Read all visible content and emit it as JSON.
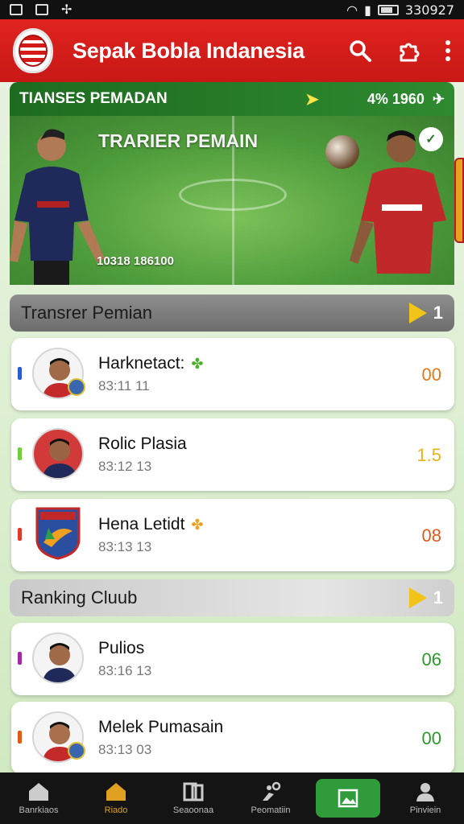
{
  "status_bar": {
    "time": "330927"
  },
  "app_bar": {
    "title": "Sepak Bobla Indanesia"
  },
  "banner": {
    "header_title": "TIANSES PEMADAN",
    "header_counter": "4% 1960",
    "title": "TRARIER PEMAIN",
    "date": "10318  186100"
  },
  "sections": [
    {
      "title": "Transrer Pemian",
      "count": "1"
    },
    {
      "title": "Ranking Cluub",
      "count": "1"
    }
  ],
  "transfer_items": [
    {
      "name": "Harknetact:",
      "time": "83:11  11",
      "value": "00",
      "value_color": "#e07a1a",
      "accent": "#2a5bd7",
      "leaf": "✤",
      "leaf_color": "#4caf2a"
    },
    {
      "name": "Rolic Plasia",
      "time": "83:12  13",
      "value": "1.5",
      "value_color": "#e7b31a",
      "accent": "#6fcf3a"
    },
    {
      "name": "Hena Letidt",
      "time": "83:13  13",
      "value": "08",
      "value_color": "#e05a1a",
      "accent": "#e03a2a",
      "leaf": "✤",
      "leaf_color": "#f0a020"
    }
  ],
  "ranking_items": [
    {
      "name": "Pulios",
      "time": "83:16  13",
      "value": "06",
      "value_color": "#2a9a2a",
      "accent": "#a02aa0"
    },
    {
      "name": "Melek Pumasain",
      "time": "83:13  03",
      "value": "00",
      "value_color": "#2a9a2a",
      "accent": "#e05a1a"
    }
  ],
  "bottom_nav": [
    {
      "label": "Banrkiaos",
      "icon": "home-icon"
    },
    {
      "label": "Riado",
      "icon": "house-icon"
    },
    {
      "label": "Seaoonaa",
      "icon": "cards-icon"
    },
    {
      "label": "Peomatiin",
      "icon": "player-kick-icon"
    },
    {
      "label": "",
      "icon": "image-icon"
    },
    {
      "label": "Pinviein",
      "icon": "profile-icon"
    }
  ]
}
